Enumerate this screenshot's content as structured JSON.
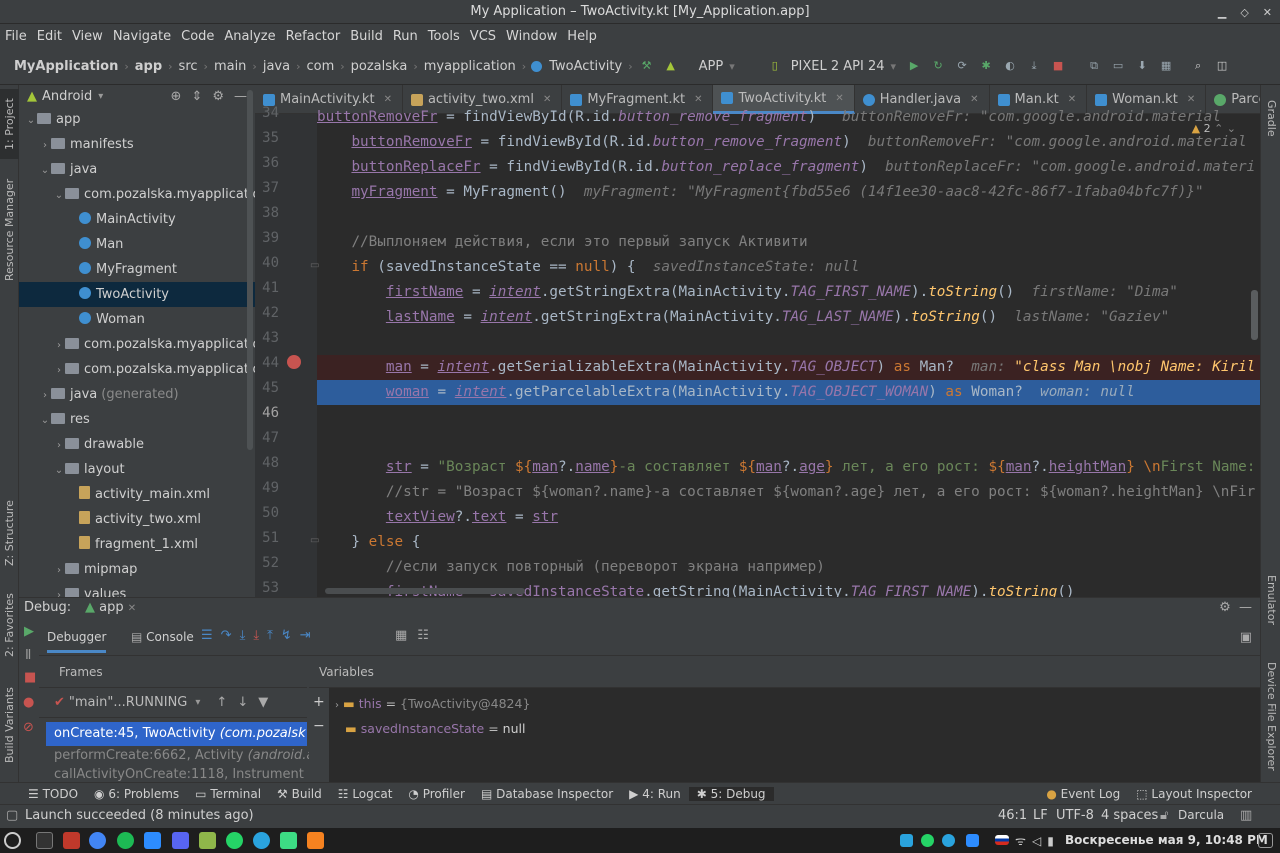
{
  "window": {
    "title": "My Application – TwoActivity.kt [My_Application.app]"
  },
  "menu": [
    "File",
    "Edit",
    "View",
    "Navigate",
    "Code",
    "Analyze",
    "Refactor",
    "Build",
    "Run",
    "Tools",
    "VCS",
    "Window",
    "Help"
  ],
  "breadcrumbs": [
    "MyApplication",
    "app",
    "src",
    "main",
    "java",
    "com",
    "pozalska",
    "myapplication",
    "TwoActivity"
  ],
  "toolbar": {
    "run_config": "APP",
    "device": "PIXEL 2 API 24"
  },
  "project_panel": {
    "view_mode": "Android",
    "tree": [
      {
        "label": "app",
        "depth": 0,
        "expanded": true,
        "type": "folder"
      },
      {
        "label": "manifests",
        "depth": 1,
        "expanded": false,
        "type": "folder"
      },
      {
        "label": "java",
        "depth": 1,
        "expanded": true,
        "type": "folder"
      },
      {
        "label": "com.pozalska.myapplication",
        "depth": 2,
        "expanded": true,
        "type": "folder"
      },
      {
        "label": "MainActivity",
        "depth": 3,
        "type": "class"
      },
      {
        "label": "Man",
        "depth": 3,
        "type": "class"
      },
      {
        "label": "MyFragment",
        "depth": 3,
        "type": "class"
      },
      {
        "label": "TwoActivity",
        "depth": 3,
        "type": "class",
        "selected": true
      },
      {
        "label": "Woman",
        "depth": 3,
        "type": "class"
      },
      {
        "label": "com.pozalska.myapplication (",
        "depth": 2,
        "expanded": false,
        "type": "folder"
      },
      {
        "label": "com.pozalska.myapplication (",
        "depth": 2,
        "expanded": false,
        "type": "folder"
      },
      {
        "label": "java",
        "suffix": "(generated)",
        "depth": 1,
        "expanded": false,
        "type": "folder"
      },
      {
        "label": "res",
        "depth": 1,
        "expanded": true,
        "type": "folder"
      },
      {
        "label": "drawable",
        "depth": 2,
        "expanded": false,
        "type": "folder"
      },
      {
        "label": "layout",
        "depth": 2,
        "expanded": true,
        "type": "folder"
      },
      {
        "label": "activity_main.xml",
        "depth": 3,
        "type": "xml"
      },
      {
        "label": "activity_two.xml",
        "depth": 3,
        "type": "xml"
      },
      {
        "label": "fragment_1.xml",
        "depth": 3,
        "type": "xml"
      },
      {
        "label": "mipmap",
        "depth": 2,
        "expanded": false,
        "type": "folder"
      },
      {
        "label": "values",
        "depth": 2,
        "expanded": false,
        "type": "folder"
      }
    ]
  },
  "editor_tabs": [
    {
      "label": "MainActivity.kt",
      "color": "#3f8fd0"
    },
    {
      "label": "activity_two.xml",
      "color": "#c7a35a"
    },
    {
      "label": "MyFragment.kt",
      "color": "#3f8fd0"
    },
    {
      "label": "TwoActivity.kt",
      "color": "#3f8fd0",
      "active": true
    },
    {
      "label": "Handler.java",
      "color": "#3f8fd0"
    },
    {
      "label": "Man.kt",
      "color": "#3f8fd0"
    },
    {
      "label": "Woman.kt",
      "color": "#3f8fd0"
    },
    {
      "label": "Parcelable.java",
      "color": "#59a869"
    }
  ],
  "editor": {
    "warnings_count": "2",
    "line_numbers": [
      "34",
      "35",
      "36",
      "37",
      "38",
      "39",
      "40",
      "41",
      "42",
      "43",
      "44",
      "45",
      "46",
      "47",
      "48",
      "49",
      "50",
      "51",
      "52",
      "53"
    ],
    "breakpoint_line": "44",
    "current_line": "45"
  },
  "debug": {
    "title": "Debug:",
    "session": "app",
    "tabs": [
      "Debugger",
      "Console"
    ],
    "frames_header": "Frames",
    "variables_header": "Variables",
    "thread": "\"main\"...RUNNING",
    "frames": [
      {
        "label": "onCreate:45, TwoActivity",
        "detail": "(com.pozalsk",
        "selected": true
      },
      {
        "label": "performCreate:6662, Activity",
        "detail": "(android.a"
      },
      {
        "label": "callActivityOnCreate:1118, Instrument",
        "detail": ""
      }
    ],
    "variables": [
      {
        "name": "this",
        "value": "{TwoActivity@4824}",
        "expandable": true
      },
      {
        "name": "savedInstanceState",
        "value": "null",
        "expandable": false
      }
    ]
  },
  "bottom_tabs": [
    {
      "label": "TODO"
    },
    {
      "label": "6: Problems"
    },
    {
      "label": "Terminal"
    },
    {
      "label": "Build"
    },
    {
      "label": "Logcat"
    },
    {
      "label": "Profiler"
    },
    {
      "label": "Database Inspector"
    },
    {
      "label": "4: Run"
    },
    {
      "label": "5: Debug",
      "active": true
    },
    {
      "label": "Event Log"
    },
    {
      "label": "Layout Inspector"
    }
  ],
  "status": {
    "message": "Launch succeeded (8 minutes ago)",
    "position": "46:1",
    "line_sep": "LF",
    "encoding": "UTF-8",
    "indent": "4 spaces",
    "theme": "Darcula"
  },
  "left_strip": [
    "1: Project",
    "Resource Manager",
    "Z: Structure",
    "2: Favorites",
    "Build Variants"
  ],
  "right_strip": [
    "Gradle",
    "Emulator",
    "Device File Explorer"
  ],
  "taskbar": {
    "clock": "Воскресенье мая 9, 10:48 PM"
  }
}
